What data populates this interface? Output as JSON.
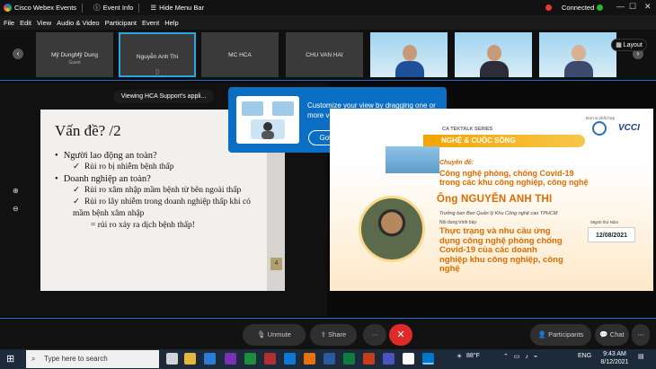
{
  "titlebar": {
    "app": "Cisco Webex Events",
    "event_info": "Event Info",
    "hide_menu": "Hide Menu Bar",
    "connected": "Connected"
  },
  "menu": [
    "File",
    "Edit",
    "View",
    "Audio & Video",
    "Participant",
    "Event",
    "Help"
  ],
  "participants": [
    {
      "name": "Mỹ DungMỹ Dung",
      "sub": "Guest"
    },
    {
      "name": "Nguyễn Anh Thi",
      "sub": ""
    },
    {
      "name": "MC HCA",
      "sub": ""
    },
    {
      "name": "CHU VAN HAI",
      "sub": ""
    }
  ],
  "layout_label": "Layout",
  "viewing_label": "Viewing HCA Support's appli...",
  "tooltip": {
    "text": "Customize your view by dragging one or more videos to the stage.",
    "button": "Got it"
  },
  "slideA": {
    "title": "Vấn đề? /2",
    "bullets": [
      {
        "level": 1,
        "text": "Người lao động an toàn?"
      },
      {
        "level": 2,
        "text": "Rủi ro bị nhiễm bệnh thấp"
      },
      {
        "level": 1,
        "text": "Doanh nghiệp an toàn?"
      },
      {
        "level": 2,
        "text": "Rủi ro xâm nhập mầm bệnh từ bên ngoài thấp"
      },
      {
        "level": 2,
        "text": "Rủi ro lây nhiễm trong doanh nghiệp thấp khi có mầm bệnh xâm nhập"
      },
      {
        "level": 3,
        "text": "= rủi ro xảy ra dịch bệnh thấp!"
      }
    ],
    "page": "4"
  },
  "slideB": {
    "hosted_by": "Đơn vị phối hợp",
    "logo": "VCCI",
    "series": "CA TEKTALK SERIES",
    "banner": "NGHỆ & CUỘC SỐNG",
    "chuyen_de": "Chuyên đề:",
    "topic1": "Công nghệ phòng, chống Covid-19 trong các khu công nghiệp, công nghệ",
    "speaker": "Ông NGUYỄN ANH THI",
    "role": "Trưởng ban Ban Quản lý Khu Công nghệ cao TPHCM",
    "topic2_pre": "Nội dung trình bày:",
    "topic2": "Thực trạng và nhu cầu ứng dụng công nghệ phòng chống Covid-19 của các doanh nghiệp khu công nghiệp, công nghệ",
    "time_pre": "09g00 thứ Năm",
    "date": "12/08/2021"
  },
  "controls": {
    "unmute": "Unmute",
    "share": "Share",
    "more": "···",
    "end": "✕",
    "participants": "Participants",
    "chat": "Chat"
  },
  "taskbar": {
    "search": "Type here to search",
    "temp": "88°F",
    "lang": "ENG",
    "time": "9:43 AM",
    "date": "8/12/2021"
  },
  "colors": {
    "accent": "#1f6fc9",
    "end": "#e02a2a",
    "tooltip": "#0a6fc4",
    "slide_orange": "#e06b00"
  }
}
